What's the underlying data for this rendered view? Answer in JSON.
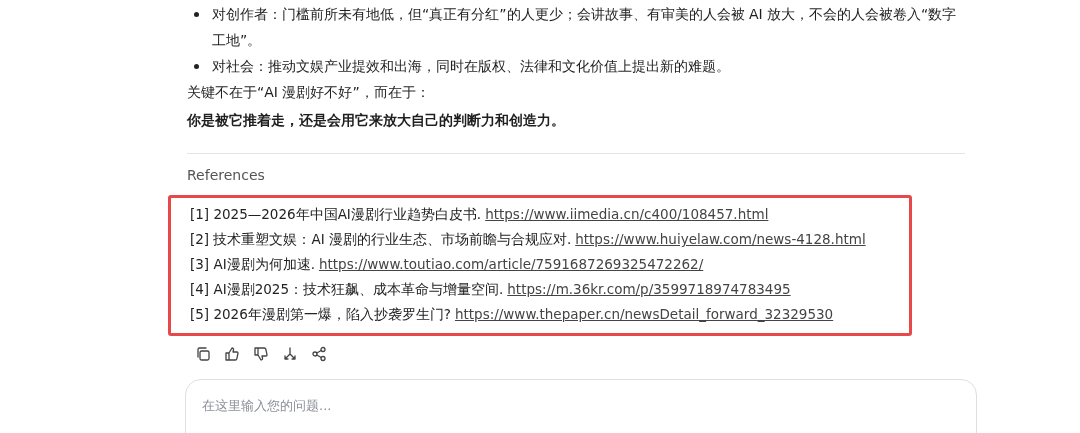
{
  "answer": {
    "bullets": [
      "对创作者：门槛前所未有地低，但“真正有分红”的人更少；会讲故事、有审美的人会被 AI 放大，不会的人会被卷入“数字工地”。",
      "对社会：推动文娱产业提效和出海，同时在版权、法律和文化价值上提出新的难题。"
    ],
    "lead": "关键不在于“AI 漫剧好不好”，而在于：",
    "conclusion": "你是被它推着走，还是会用它来放大自己的判断力和创造力。"
  },
  "references": {
    "title": "References",
    "highlighted": true,
    "items": [
      {
        "index": "[1]",
        "text": "2025—2026年中国AI漫剧行业趋势白皮书.",
        "url": "https://www.iimedia.cn/c400/108457.html"
      },
      {
        "index": "[2]",
        "text": "技术重塑文娱：AI 漫剧的行业生态、市场前瞻与合规应对.",
        "url": "https://www.huiyelaw.com/news-4128.html"
      },
      {
        "index": "[3]",
        "text": "AI漫剧为何加速.",
        "url": "https://www.toutiao.com/article/7591687269325472262/"
      },
      {
        "index": "[4]",
        "text": "AI漫剧2025：技术狂飙、成本革命与增量空间.",
        "url": "https://m.36kr.com/p/3599718974783495"
      },
      {
        "index": "[5]",
        "text": "2026年漫剧第一爆，陷入抄袭罗生门?",
        "url": "https://www.thepaper.cn/newsDetail_forward_32329530"
      }
    ]
  },
  "actions": [
    {
      "kind": "copy"
    },
    {
      "kind": "like"
    },
    {
      "kind": "dislike"
    },
    {
      "kind": "branch"
    },
    {
      "kind": "share"
    }
  ],
  "input": {
    "placeholder": "在这里输入您的问题..."
  }
}
